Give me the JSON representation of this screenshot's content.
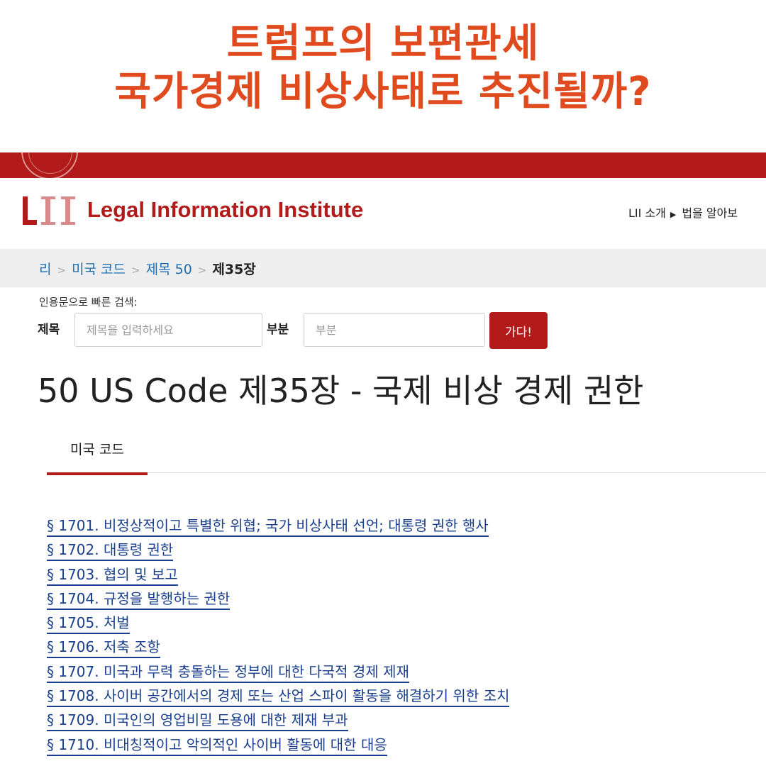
{
  "headline": {
    "line1": "트럼프의 보편관세",
    "line2": "국가경제 비상사태로 추진될까?"
  },
  "colors": {
    "accent": "#e04a1f",
    "brand_red": "#b31b1b",
    "link": "#1a3f8f"
  },
  "site": {
    "logo_letters": "LII",
    "name": "Legal Information Institute",
    "nav": [
      "LII 소개",
      "법을 알아보"
    ]
  },
  "breadcrumb": {
    "items": [
      "리",
      "미국 코드",
      "제목 50"
    ],
    "current": "제35장"
  },
  "quick_search": {
    "label": "인용문으로 빠른 검색:",
    "title_label": "제목",
    "title_placeholder": "제목을 입력하세요",
    "section_label": "부분",
    "section_placeholder": "부분",
    "go_label": "가다!"
  },
  "page_title": "50 US Code 제35장 - 국제 비상 경제 권한",
  "tabs": [
    {
      "label": "미국 코드",
      "active": true
    }
  ],
  "sections": [
    "§ 1701. 비정상적이고 특별한 위협; 국가 비상사태 선언; 대통령 권한 행사",
    "§ 1702. 대통령 권한",
    "§ 1703. 협의 및 보고",
    "§ 1704. 규정을 발행하는 권한",
    "§ 1705. 처벌",
    "§ 1706. 저축 조항",
    "§ 1707. 미국과 무력 충돌하는 정부에 대한 다국적 경제 제재",
    "§ 1708. 사이버 공간에서의 경제 또는 산업 스파이 활동을 해결하기 위한 조치",
    "§ 1709. 미국인의 영업비밀 도용에 대한 제재 부과",
    "§ 1710. 비대칭적이고 악의적인 사이버 활동에 대한 대응"
  ]
}
